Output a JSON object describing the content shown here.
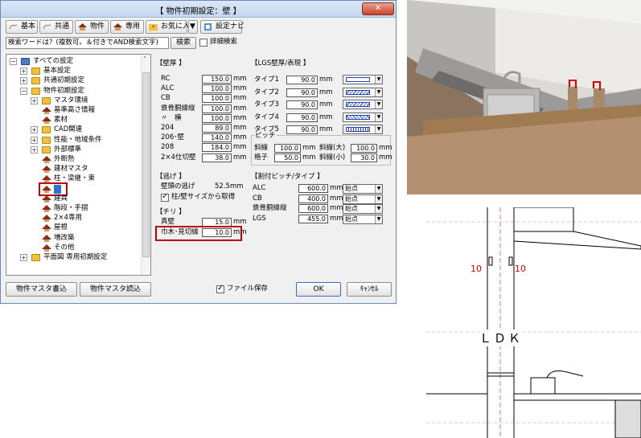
{
  "dialog": {
    "title": "【 物件初期設定：壁 】",
    "close": "✕"
  },
  "toolbar": {
    "items": [
      "基本",
      "共通",
      "物件",
      "専用",
      "お気に入り",
      "設定ナビ"
    ],
    "dropdown": "▼"
  },
  "search": {
    "value": "検索ワードは？(複数可。＆付きでAND検索文字)",
    "button": "検索",
    "detail_label": "詳細検索"
  },
  "tree": {
    "items": [
      {
        "label": "すべての設定",
        "exp": "⊟"
      },
      {
        "label": "基本設定",
        "exp": "⊞"
      },
      {
        "label": "共通初期設定",
        "exp": "⊞"
      },
      {
        "label": "物件初期設定",
        "exp": "⊟"
      },
      {
        "label": "マスタ環境",
        "exp": "⊞"
      },
      {
        "label": "基準高さ情報",
        "exp": ""
      },
      {
        "label": "素材",
        "exp": ""
      },
      {
        "label": "CAD関連",
        "exp": "⊞"
      },
      {
        "label": "性能・地域条件",
        "exp": "⊞"
      },
      {
        "label": "外部標準",
        "exp": "⊞"
      },
      {
        "label": "外断熱",
        "exp": ""
      },
      {
        "label": "建材マスタ",
        "exp": ""
      },
      {
        "label": "柱・梁継・束",
        "exp": ""
      },
      {
        "label": "壁",
        "exp": ""
      },
      {
        "label": "建具",
        "exp": ""
      },
      {
        "label": "階段・手摺",
        "exp": ""
      },
      {
        "label": "2×4専用",
        "exp": ""
      },
      {
        "label": "屋根",
        "exp": ""
      },
      {
        "label": "増改築",
        "exp": ""
      },
      {
        "label": "その他",
        "exp": ""
      },
      {
        "label": "平面図 専用初期設定",
        "exp": "⊞"
      }
    ]
  },
  "kabeatsu": {
    "title": "【壁厚 】",
    "unit": "mm",
    "rows": [
      {
        "label": "RC",
        "value": "150.0"
      },
      {
        "label": "ALC",
        "value": "100.0"
      },
      {
        "label": "CB",
        "value": "100.0"
      },
      {
        "label": "鉄骨胴縁縦",
        "value": "100.0"
      },
      {
        "label": "〃　横",
        "value": "100.0"
      },
      {
        "label": "204",
        "value": "89.0"
      },
      {
        "label": "206･壁",
        "value": "140.0"
      },
      {
        "label": "208",
        "value": "184.0"
      },
      {
        "label": "2×4仕切壁",
        "value": "38.0"
      }
    ]
  },
  "lgs": {
    "title": "【LGS壁厚/表現 】",
    "unit": "mm",
    "rows": [
      {
        "label": "タイプ1",
        "value": "90.0"
      },
      {
        "label": "タイプ2",
        "value": "90.0"
      },
      {
        "label": "タイプ3",
        "value": "90.0"
      },
      {
        "label": "タイプ4",
        "value": "90.0"
      },
      {
        "label": "タイプ5",
        "value": "90.0"
      }
    ],
    "pitch_title": "ピッチ",
    "pitch": [
      {
        "label": "斜線",
        "value": "100.0",
        "label2": "斜線(大)",
        "value2": "100.0"
      },
      {
        "label": "格子",
        "value": "50.0",
        "label2": "斜線(小)",
        "value2": "30.0"
      }
    ]
  },
  "nige": {
    "title": "【逃げ 】",
    "label": "壁頭の逃げ",
    "value": "52.5",
    "unit": "mm",
    "check_label": "柱/壁サイズから取得"
  },
  "chiri": {
    "title": "【チリ 】",
    "rows": [
      {
        "label": "真壁",
        "value": "15.0"
      },
      {
        "label": "巾木･見切縁",
        "value": "10.0"
      }
    ],
    "unit": "mm"
  },
  "waritsuke": {
    "title": "【割付ピッチ/タイプ 】",
    "unit": "mm",
    "rows": [
      {
        "label": "ALC",
        "value": "600.0",
        "type": "始点"
      },
      {
        "label": "CB",
        "value": "400.0",
        "type": "始点"
      },
      {
        "label": "鉄骨胴縁縦",
        "value": "600.0",
        "type": "始点"
      },
      {
        "label": "LGS",
        "value": "455.0",
        "type": "始点"
      }
    ]
  },
  "bottom": {
    "master_write": "物件マスタ書込",
    "master_read": "物件マスタ読込",
    "file_save": "ファイル保存",
    "ok": "OK",
    "cancel": "ｷｬﾝｾﾙ"
  },
  "plan": {
    "dim_left": "10",
    "dim_right": "10",
    "room": "ＬＤＫ"
  },
  "colors": {
    "highlight": "#c00000",
    "title_bg": "#c4d6ee"
  }
}
